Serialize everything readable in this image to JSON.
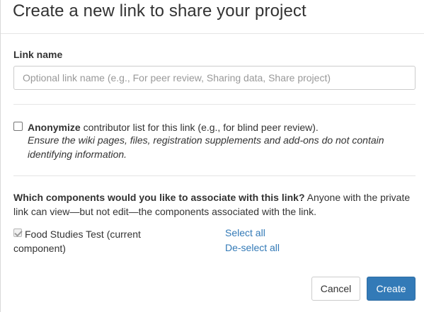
{
  "dialog": {
    "title": "Create a new link to share your project"
  },
  "link_name": {
    "label": "Link name",
    "value": "",
    "placeholder": "Optional link name (e.g., For peer review, Sharing data, Share project)"
  },
  "anonymize": {
    "checked": false,
    "bold_text": "Anonymize",
    "text": " contributor list for this link (e.g., for blind peer review).",
    "note": "Ensure the wiki pages, files, registration supplements and add-ons do not contain identifying information."
  },
  "components": {
    "question_bold": "Which components would you like to associate with this link?",
    "question_text": " Anyone with the private link can view—but not edit—the components associated with the link.",
    "items": [
      {
        "label": "Food Studies Test (current component)",
        "checked": true,
        "disabled": true
      }
    ],
    "select_all": "Select all",
    "deselect_all": "De-select all"
  },
  "footer": {
    "cancel_label": "Cancel",
    "create_label": "Create"
  },
  "colors": {
    "primary": "#337ab7",
    "link": "#337ab7"
  }
}
